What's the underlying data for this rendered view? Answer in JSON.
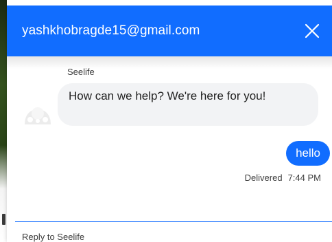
{
  "header": {
    "title": "yashkhobragde15@gmail.com",
    "close_icon": "close-icon"
  },
  "conversation": {
    "agent_name": "Seelife",
    "agent_avatar_icon": "avatar-icon",
    "messages": [
      {
        "from": "agent",
        "text": "How can we help? We're here for you!"
      },
      {
        "from": "user",
        "text": "hello"
      }
    ],
    "status": {
      "state": "Delivered",
      "time": "7:44 PM"
    }
  },
  "reply": {
    "placeholder": "Reply to Seelife"
  },
  "colors": {
    "brand": "#116dff",
    "bubble_in": "#f2f3f5"
  }
}
